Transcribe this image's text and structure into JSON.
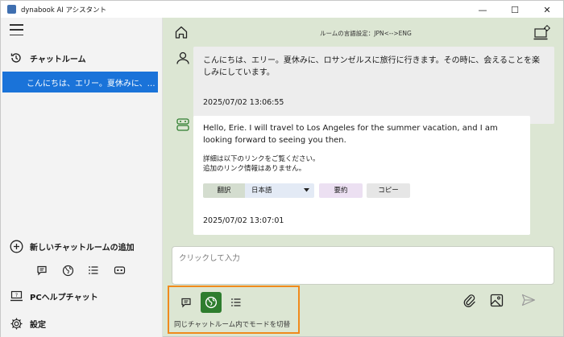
{
  "window": {
    "title": "dynabook AI アシスタント",
    "controls": [
      "—",
      "☐",
      "✕"
    ]
  },
  "sidebar": {
    "chat_room_label": "チャットルーム",
    "rooms": [
      {
        "label": "こんにちは、エリー。夏休みに、…",
        "selected": true
      }
    ],
    "add_room_label": "新しいチャットルームの追加",
    "pc_help_label": "PCヘルプチャット",
    "settings_label": "設定",
    "mode_icons": [
      "chat-icon",
      "globe-icon",
      "list-icon",
      "robot-icon"
    ]
  },
  "header": {
    "language_setting": "ルームの言語設定：JPN<-->ENG"
  },
  "messages": {
    "user": {
      "text": "こんにちは、エリー。夏休みに、ロサンゼルスに旅行に行きます。その時に、会えることを楽しみにしています。",
      "timestamp": "2025/07/02 13:06:55"
    },
    "bot": {
      "text": "Hello, Erie. I will travel to Los Angeles for the summer vacation, and I am looking forward to seeing you then.",
      "note_line1": "詳細は以下のリンクをご覧ください。",
      "note_line2": "追加のリンク情報はありません。",
      "translate_label": "翻訳",
      "language_value": "日本語",
      "summary_label": "要約",
      "copy_label": "コピー",
      "timestamp": "2025/07/02 13:07:01"
    }
  },
  "input": {
    "placeholder": "クリックして入力"
  },
  "mode_switch": {
    "caption": "同じチャットルーム内でモードを切替",
    "active": "globe-icon"
  },
  "colors": {
    "accent": "#1a73d9",
    "main_bg": "#dce6d3",
    "active_mode": "#2e7d2e",
    "highlight": "#f08a1c"
  }
}
